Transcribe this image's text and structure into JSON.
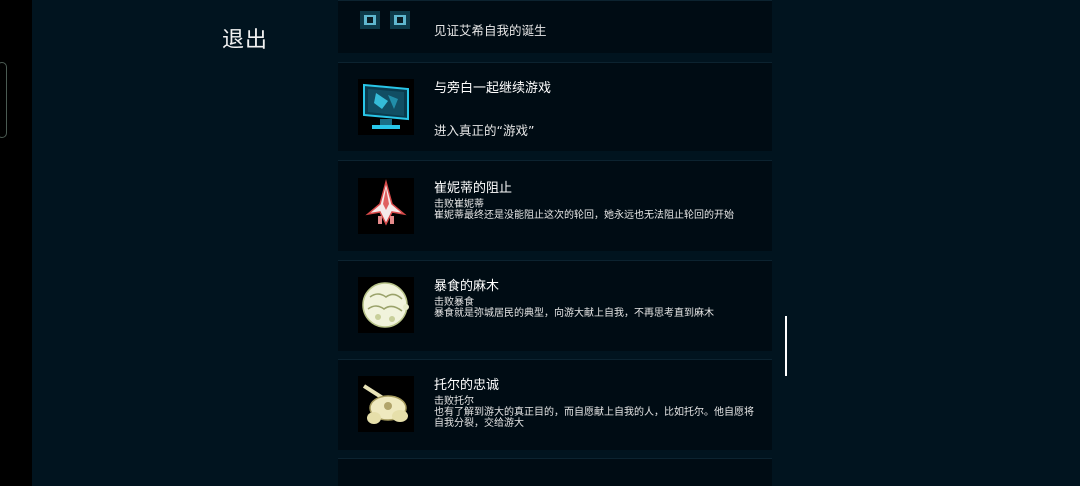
{
  "exit_label": "退出",
  "achievements": [
    {
      "title": "",
      "description": "见证艾希自我的诞生",
      "icon": "portrait-icon"
    },
    {
      "title": "与旁白一起继续游戏",
      "description": "进入真正的“游戏”",
      "icon": "monitor-icon"
    },
    {
      "title": "崔妮蒂的阻止",
      "subtitle": "击败崔妮蒂",
      "description": "崔妮蒂最终还是没能阻止这次的轮回，她永远也无法阻止轮回的开始",
      "icon": "spaceship-icon"
    },
    {
      "title": "暴食的麻木",
      "subtitle": "击败暴食",
      "description": "暴食就是弥城居民的典型，向游大献上自我，不再思考直到麻木",
      "icon": "glutton-icon"
    },
    {
      "title": "托尔的忠诚",
      "subtitle": "击败托尔",
      "description": "也有了解到游大的真正目的，而自愿献上自我的人，比如托尔。他自愿将自我分裂，交给游大",
      "icon": "tank-icon"
    }
  ]
}
